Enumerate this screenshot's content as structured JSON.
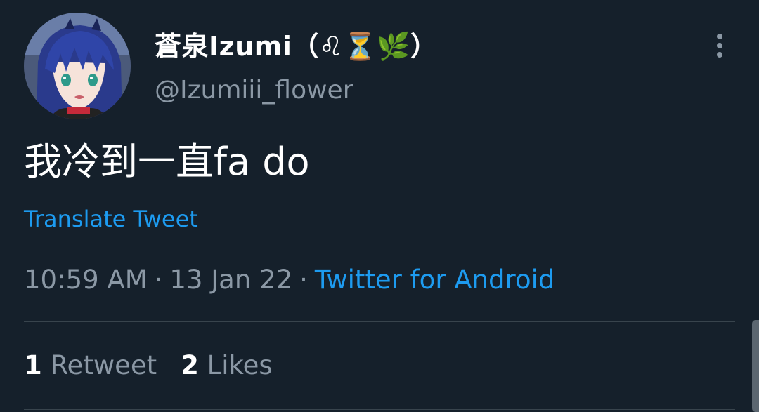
{
  "tweet": {
    "display_name": "蒼泉Izumi（♌⏳🌿）",
    "handle": "@Izumiii_flower",
    "text": "我冷到一直fa do",
    "translate_label": "Translate Tweet",
    "time": "10:59 AM",
    "date": "13 Jan 22",
    "separator": "·",
    "source": "Twitter for Android",
    "retweet_count": "1",
    "retweet_label": "Retweet",
    "likes_count": "2",
    "likes_label": "Likes"
  },
  "icons": {
    "more": "more-vertical-icon",
    "avatar": "anime-avatar-image"
  },
  "colors": {
    "background": "#15202b",
    "primary_text": "#ffffff",
    "secondary_text": "#8b98a5",
    "link": "#1d9bf0",
    "divider": "#38444d"
  }
}
